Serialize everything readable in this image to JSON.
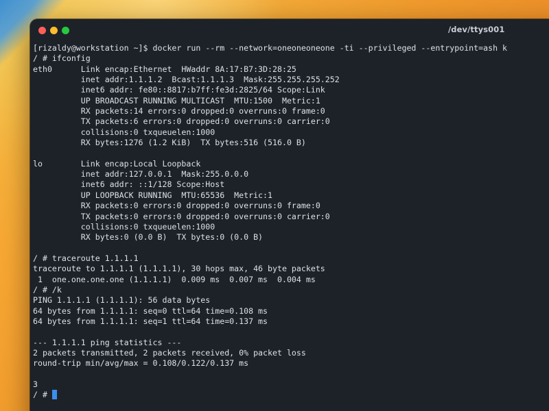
{
  "window": {
    "title": "/dev/ttys001",
    "controls": {
      "close_color": "#ff5f57",
      "minimize_color": "#febc2e",
      "zoom_color": "#28c840"
    }
  },
  "terminal": {
    "background_color": "#1d2229",
    "text_color": "#dde1e6",
    "cursor_color": "#3b8eea",
    "lines": [
      "[rizaldy@workstation ~]$ docker run --rm --network=oneoneoneone -ti --privileged --entrypoint=ash k",
      "/ # ifconfig",
      "eth0      Link encap:Ethernet  HWaddr 8A:17:B7:3D:28:25",
      "          inet addr:1.1.1.2  Bcast:1.1.1.3  Mask:255.255.255.252",
      "          inet6 addr: fe80::8817:b7ff:fe3d:2825/64 Scope:Link",
      "          UP BROADCAST RUNNING MULTICAST  MTU:1500  Metric:1",
      "          RX packets:14 errors:0 dropped:0 overruns:0 frame:0",
      "          TX packets:6 errors:0 dropped:0 overruns:0 carrier:0",
      "          collisions:0 txqueuelen:1000",
      "          RX bytes:1276 (1.2 KiB)  TX bytes:516 (516.0 B)",
      "",
      "lo        Link encap:Local Loopback",
      "          inet addr:127.0.0.1  Mask:255.0.0.0",
      "          inet6 addr: ::1/128 Scope:Host",
      "          UP LOOPBACK RUNNING  MTU:65536  Metric:1",
      "          RX packets:0 errors:0 dropped:0 overruns:0 frame:0",
      "          TX packets:0 errors:0 dropped:0 overruns:0 carrier:0",
      "          collisions:0 txqueuelen:1000",
      "          RX bytes:0 (0.0 B)  TX bytes:0 (0.0 B)",
      "",
      "/ # traceroute 1.1.1.1",
      "traceroute to 1.1.1.1 (1.1.1.1), 30 hops max, 46 byte packets",
      " 1  one.one.one.one (1.1.1.1)  0.009 ms  0.007 ms  0.004 ms",
      "/ # /k",
      "PING 1.1.1.1 (1.1.1.1): 56 data bytes",
      "64 bytes from 1.1.1.1: seq=0 ttl=64 time=0.108 ms",
      "64 bytes from 1.1.1.1: seq=1 ttl=64 time=0.137 ms",
      "",
      "--- 1.1.1.1 ping statistics ---",
      "2 packets transmitted, 2 packets received, 0% packet loss",
      "round-trip min/avg/max = 0.108/0.122/0.137 ms",
      "",
      "3"
    ],
    "prompt": "/ # "
  }
}
